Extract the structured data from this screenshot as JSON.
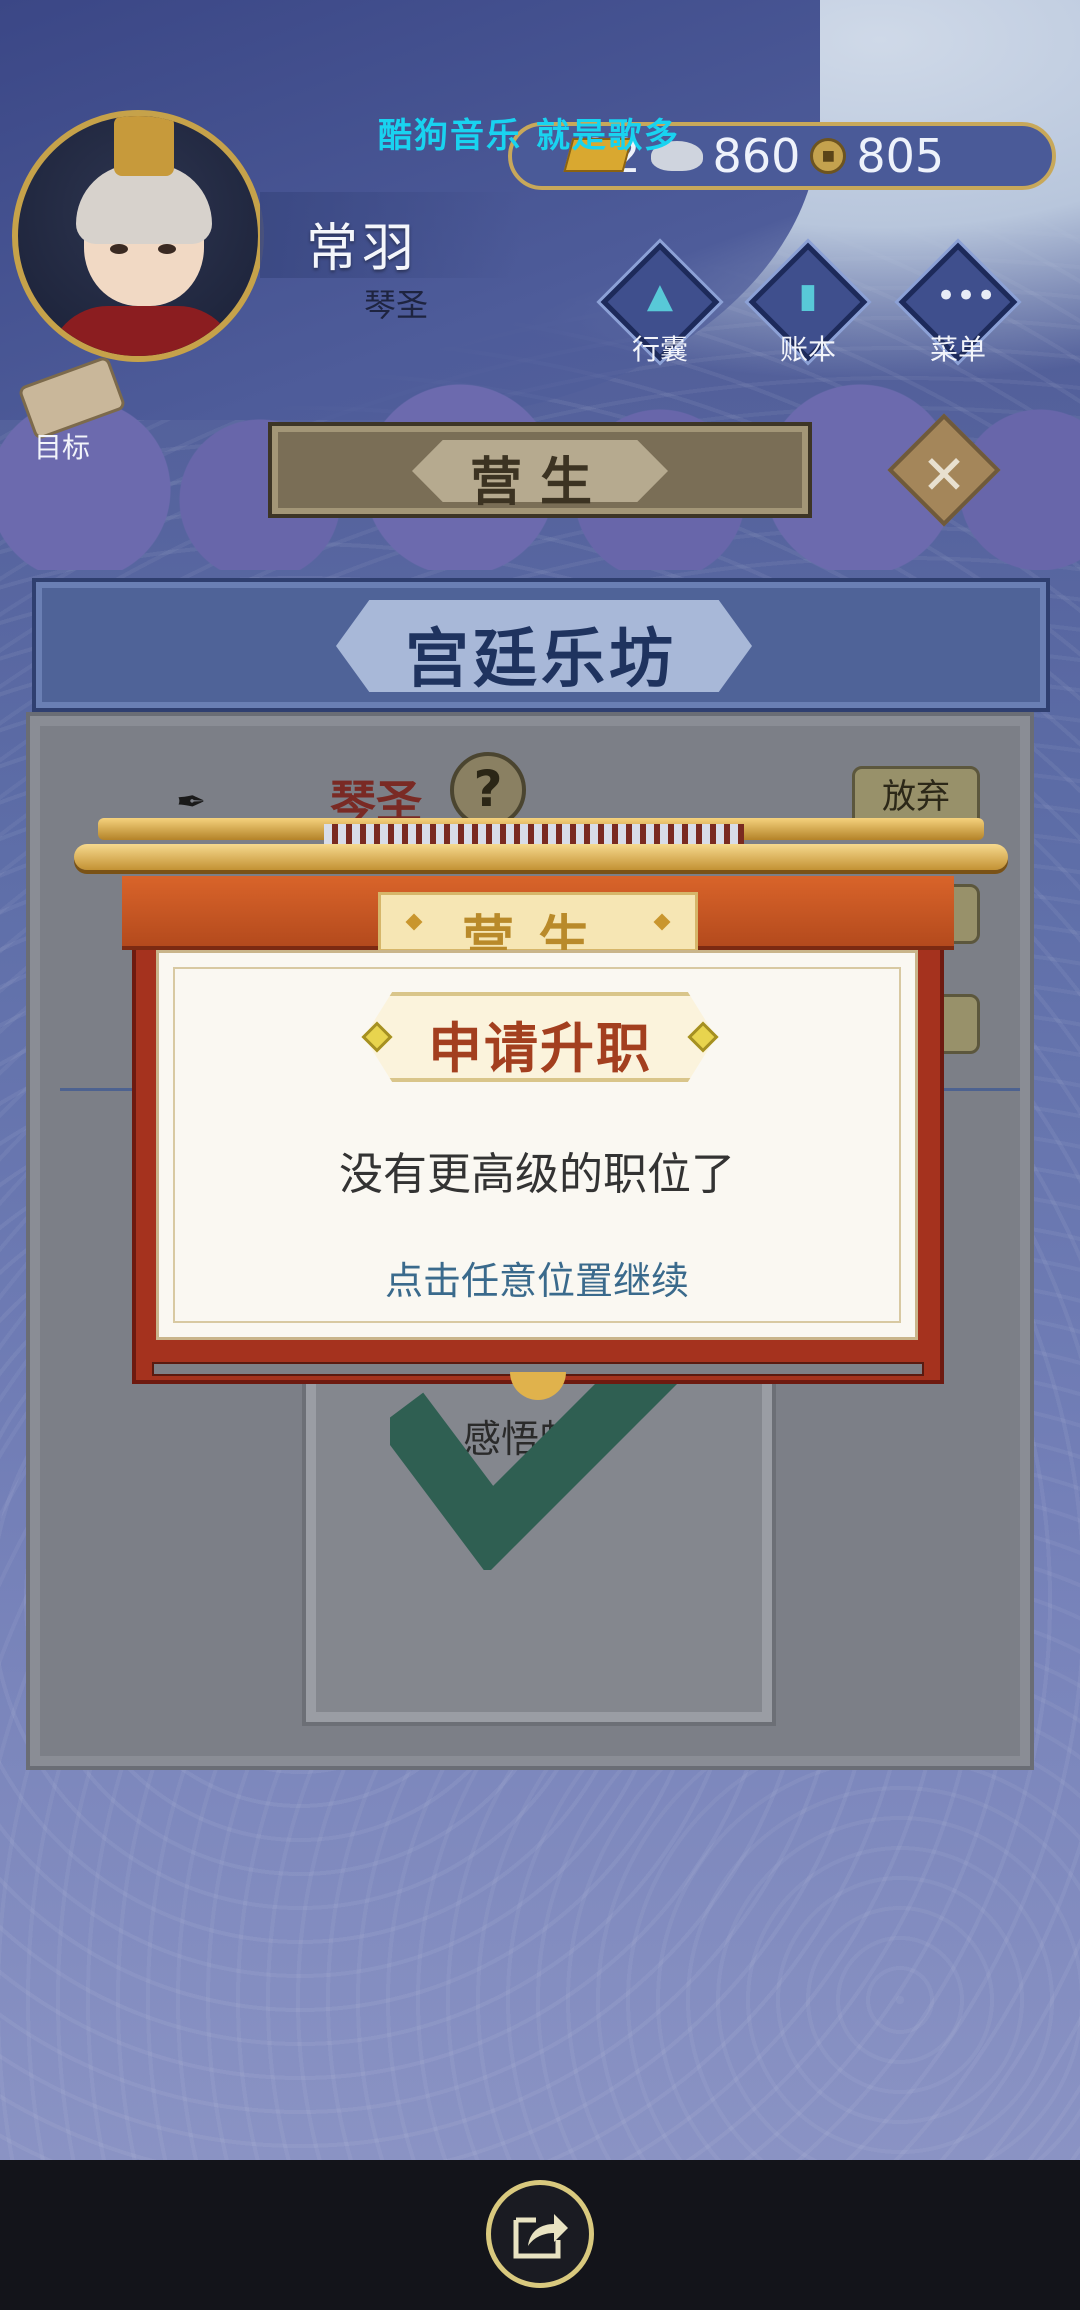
{
  "watermark": "酷狗音乐 就是歌多",
  "player": {
    "name": "常羽",
    "title": "琴圣"
  },
  "currency": {
    "gold": "22",
    "silver": "860",
    "copper": "805"
  },
  "menu": {
    "bag": "行囊",
    "ledger": "账本",
    "menu": "菜单"
  },
  "target": {
    "label": "目标"
  },
  "section_banner": "营生",
  "panel": {
    "title": "宫廷乐坊",
    "role": "琴圣",
    "help": "?",
    "abandon": "放弃",
    "card_text": "感悟颇多"
  },
  "modal": {
    "header": "营生",
    "subtitle": "申请升职",
    "message": "没有更高级的职位了",
    "hint": "点击任意位置继续"
  },
  "icons": {
    "close": "close-icon",
    "share": "share-icon",
    "check": "checkmark-icon"
  },
  "colors": {
    "modal_frame": "#a5321e",
    "modal_header": "#d9642a",
    "subtitle_text": "#a33f1f",
    "hint_text": "#3a6a8c",
    "watermark": "#19d3f0"
  }
}
